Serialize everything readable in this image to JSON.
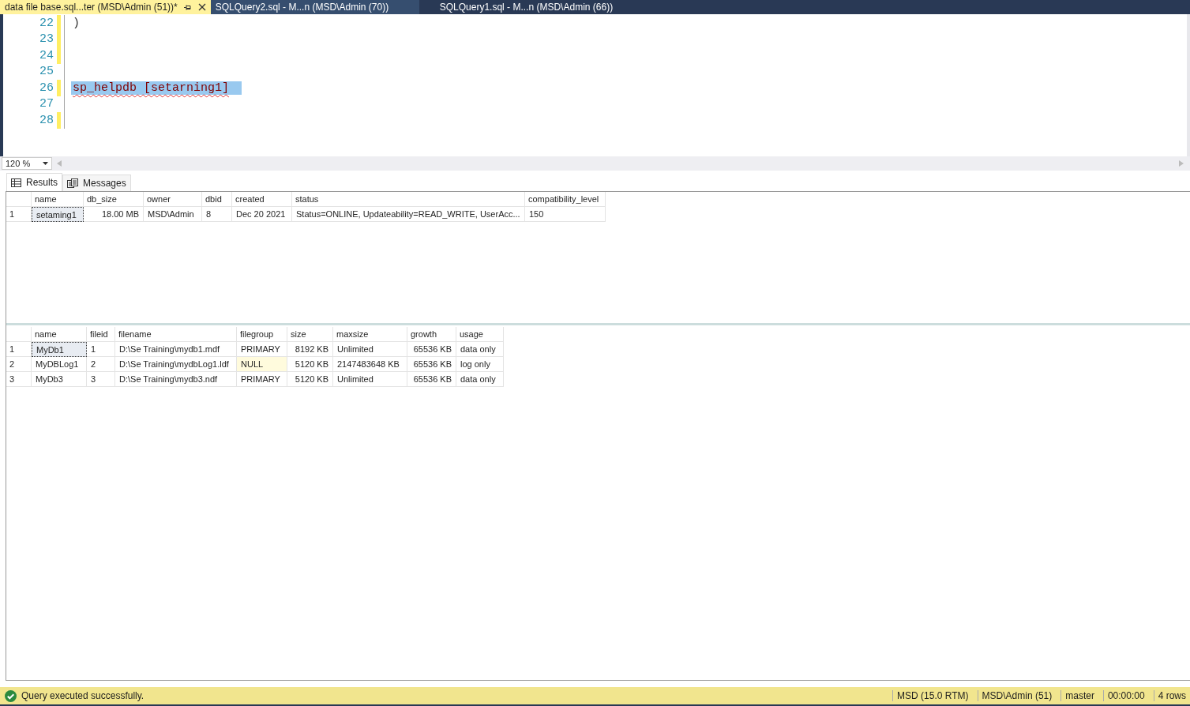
{
  "tabs": [
    {
      "label": "data file base.sql...ter (MSD\\Admin (51))*",
      "selected": true
    },
    {
      "label": "SQLQuery2.sql - M...n (MSD\\Admin (70))",
      "selected": false
    },
    {
      "label": "SQLQuery1.sql - M...n (MSD\\Admin (66))",
      "selected": false
    }
  ],
  "editor": {
    "lines": [
      {
        "number": "22",
        "text": ")",
        "changed": true,
        "selected": false
      },
      {
        "number": "23",
        "changed": true,
        "selected": false
      },
      {
        "number": "24",
        "changed": true,
        "selected": false
      },
      {
        "number": "25",
        "changed": false,
        "selected": false
      },
      {
        "number": "26",
        "text": "sp_helpdb [setarning1]",
        "changed": true,
        "selected": true
      },
      {
        "number": "27",
        "changed": false,
        "selected": false
      },
      {
        "number": "28",
        "changed": true,
        "selected": false
      }
    ],
    "zoom": "120 %"
  },
  "result_tabs": [
    {
      "label": "Results",
      "kind": "grid",
      "selected": true
    },
    {
      "label": "Messages",
      "kind": "messages",
      "selected": false
    }
  ],
  "grids": [
    {
      "columns": [
        "name",
        "db_size",
        "owner",
        "dbid",
        "created",
        "status",
        "compatibility_level"
      ],
      "rows": [
        {
          "number": "1",
          "selected": true,
          "cells": [
            {
              "text": "setaming1",
              "null": false
            },
            {
              "text": "18.00 MB",
              "null": false
            },
            {
              "text": "MSD\\Admin",
              "null": false
            },
            {
              "text": "8",
              "null": false
            },
            {
              "text": "Dec 20 2021",
              "null": false
            },
            {
              "text": "Status=ONLINE, Updateability=READ_WRITE, UserAcc...",
              "null": false
            },
            {
              "text": "150",
              "null": false
            }
          ]
        }
      ]
    },
    {
      "columns": [
        "name",
        "fileid",
        "filename",
        "filegroup",
        "size",
        "maxsize",
        "growth",
        "usage"
      ],
      "rows": [
        {
          "number": "1",
          "selected": true,
          "cells": [
            {
              "text": "MyDb1",
              "null": false
            },
            {
              "text": "1",
              "null": false
            },
            {
              "text": "D:\\Se Training\\mydb1.mdf",
              "null": false
            },
            {
              "text": "PRIMARY",
              "null": false
            },
            {
              "text": "8192 KB",
              "null": false
            },
            {
              "text": "Unlimited",
              "null": false
            },
            {
              "text": "65536 KB",
              "null": false
            },
            {
              "text": "data only",
              "null": false
            }
          ]
        },
        {
          "number": "2",
          "selected": false,
          "cells": [
            {
              "text": "MyDBLog1",
              "null": false
            },
            {
              "text": "2",
              "null": false
            },
            {
              "text": "D:\\Se Training\\mydbLog1.ldf",
              "null": false
            },
            {
              "text": "NULL",
              "null": true
            },
            {
              "text": "5120 KB",
              "null": false
            },
            {
              "text": "2147483648 KB",
              "null": false
            },
            {
              "text": "65536 KB",
              "null": false
            },
            {
              "text": "log only",
              "null": false
            }
          ]
        },
        {
          "number": "3",
          "selected": false,
          "cells": [
            {
              "text": "MyDb3",
              "null": false
            },
            {
              "text": "3",
              "null": false
            },
            {
              "text": "D:\\Se Training\\mydb3.ndf",
              "null": false
            },
            {
              "text": "PRIMARY",
              "null": false
            },
            {
              "text": "5120 KB",
              "null": false
            },
            {
              "text": "Unlimited",
              "null": false
            },
            {
              "text": "65536 KB",
              "null": false
            },
            {
              "text": "data only",
              "null": false
            }
          ]
        }
      ]
    }
  ],
  "status_bar": {
    "message": "Query executed successfully.",
    "segments": [
      "MSD (15.0 RTM)",
      "MSD\\Admin (51)",
      "master",
      "00:00:00",
      "4 rows"
    ]
  }
}
